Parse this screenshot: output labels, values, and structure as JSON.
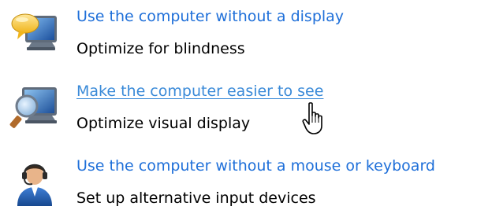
{
  "items": [
    {
      "link_text": "Use the computer without a display",
      "description": "Optimize for blindness",
      "icon": "speech-bubble-monitor-icon"
    },
    {
      "link_text": "Make the computer easier to see",
      "description": "Optimize visual display",
      "icon": "magnifier-monitor-icon",
      "state": "hovered"
    },
    {
      "link_text": "Use the computer without a mouse or keyboard",
      "description": "Set up alternative input devices",
      "icon": "headset-person-icon"
    }
  ],
  "cursor": "hand-pointer-icon",
  "colors": {
    "link": "#1e6fd9",
    "link_hover": "#3a8ad8",
    "description": "#000000"
  }
}
